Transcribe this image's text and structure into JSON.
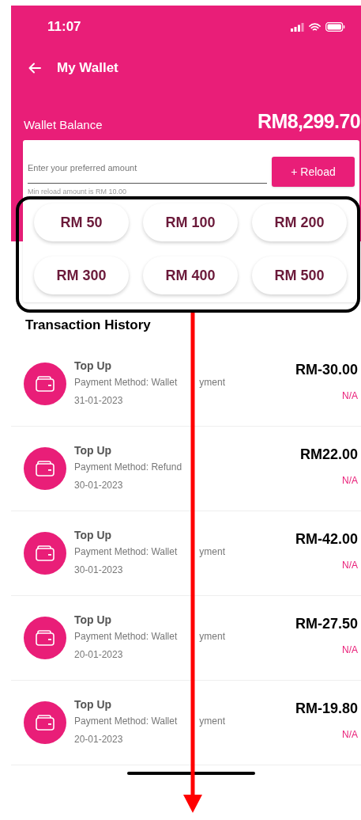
{
  "status_bar": {
    "time": "11:07"
  },
  "header": {
    "title": "My Wallet"
  },
  "wallet_balance": {
    "label": "Wallet Balance",
    "value": "RM8,299.70"
  },
  "reload": {
    "placeholder": "Enter your preferred amount",
    "button": "+ Reload",
    "hint": "Min reload amount is RM 10.00"
  },
  "amounts": [
    "RM 50",
    "RM 100",
    "RM 200",
    "RM 300",
    "RM 400",
    "RM 500"
  ],
  "transaction_history": {
    "title": "Transaction History",
    "items": [
      {
        "title": "Top Up",
        "method": "Payment Method: Wallet",
        "method_rest": "yment",
        "date": "31-01-2023",
        "amount": "RM-30.00",
        "status": "N/A"
      },
      {
        "title": "Top Up",
        "method": "Payment Method: Refund",
        "date": "30-01-2023",
        "amount": "RM22.00",
        "status": "N/A"
      },
      {
        "title": "Top Up",
        "method": "Payment Method: Wallet",
        "method_rest": "yment",
        "date": "30-01-2023",
        "amount": "RM-42.00",
        "status": "N/A"
      },
      {
        "title": "Top Up",
        "method": "Payment Method: Wallet",
        "method_rest": "yment",
        "date": "20-01-2023",
        "amount": "RM-27.50",
        "status": "N/A"
      },
      {
        "title": "Top Up",
        "method": "Payment Method: Wallet",
        "method_rest": "yment",
        "date": "20-01-2023",
        "amount": "RM-19.80",
        "status": "N/A"
      }
    ]
  }
}
